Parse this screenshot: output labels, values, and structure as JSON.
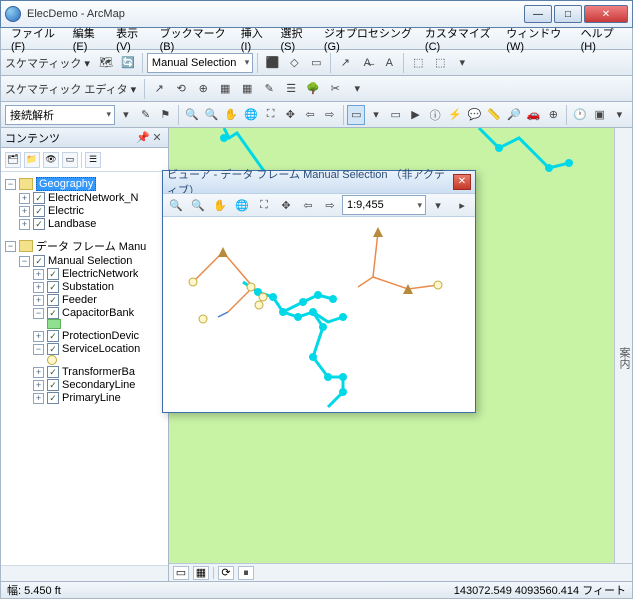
{
  "window": {
    "title": "ElecDemo - ArcMap"
  },
  "menu": {
    "file": "ファイル(F)",
    "edit": "編集(E)",
    "view": "表示(V)",
    "bookmark": "ブックマーク(B)",
    "insert": "挿入(I)",
    "select": "選択(S)",
    "geoprocessing": "ジオプロセシング(G)",
    "customize": "カスタマイズ(C)",
    "window": "ウィンドウ(W)",
    "help": "ヘルプ(H)"
  },
  "toolbar1": {
    "label": "スケマティック ▾",
    "combo": "Manual Selection"
  },
  "toolbar2": {
    "label": "スケマティック エディタ ▾"
  },
  "toolbar3": {
    "combo": "接続解析"
  },
  "toc": {
    "title": "コンテンツ",
    "items": {
      "geography": "Geography",
      "electricnetwork_n": "ElectricNetwork_N",
      "electric": "Electric",
      "landbase": "Landbase",
      "dataframe": "データ フレーム Manu",
      "manualselection": "Manual Selection",
      "electricnetwork": "ElectricNetwork",
      "substation": "Substation",
      "feeder": "Feeder",
      "capacitorbank": "CapacitorBank",
      "protectiondevice": "ProtectionDevic",
      "servicelocation": "ServiceLocation",
      "transformerba": "TransformerBa",
      "secondaryline": "SecondaryLine",
      "primaryline": "PrimaryLine"
    }
  },
  "viewer": {
    "title": "ビューア - データ フレーム Manual Selection  （非アクティブ）",
    "scale": "1:9,455"
  },
  "rightstrip": "案内",
  "status": {
    "left": "幅: 5.450 ft",
    "right": "143072.549 4093560.414 フィート"
  }
}
